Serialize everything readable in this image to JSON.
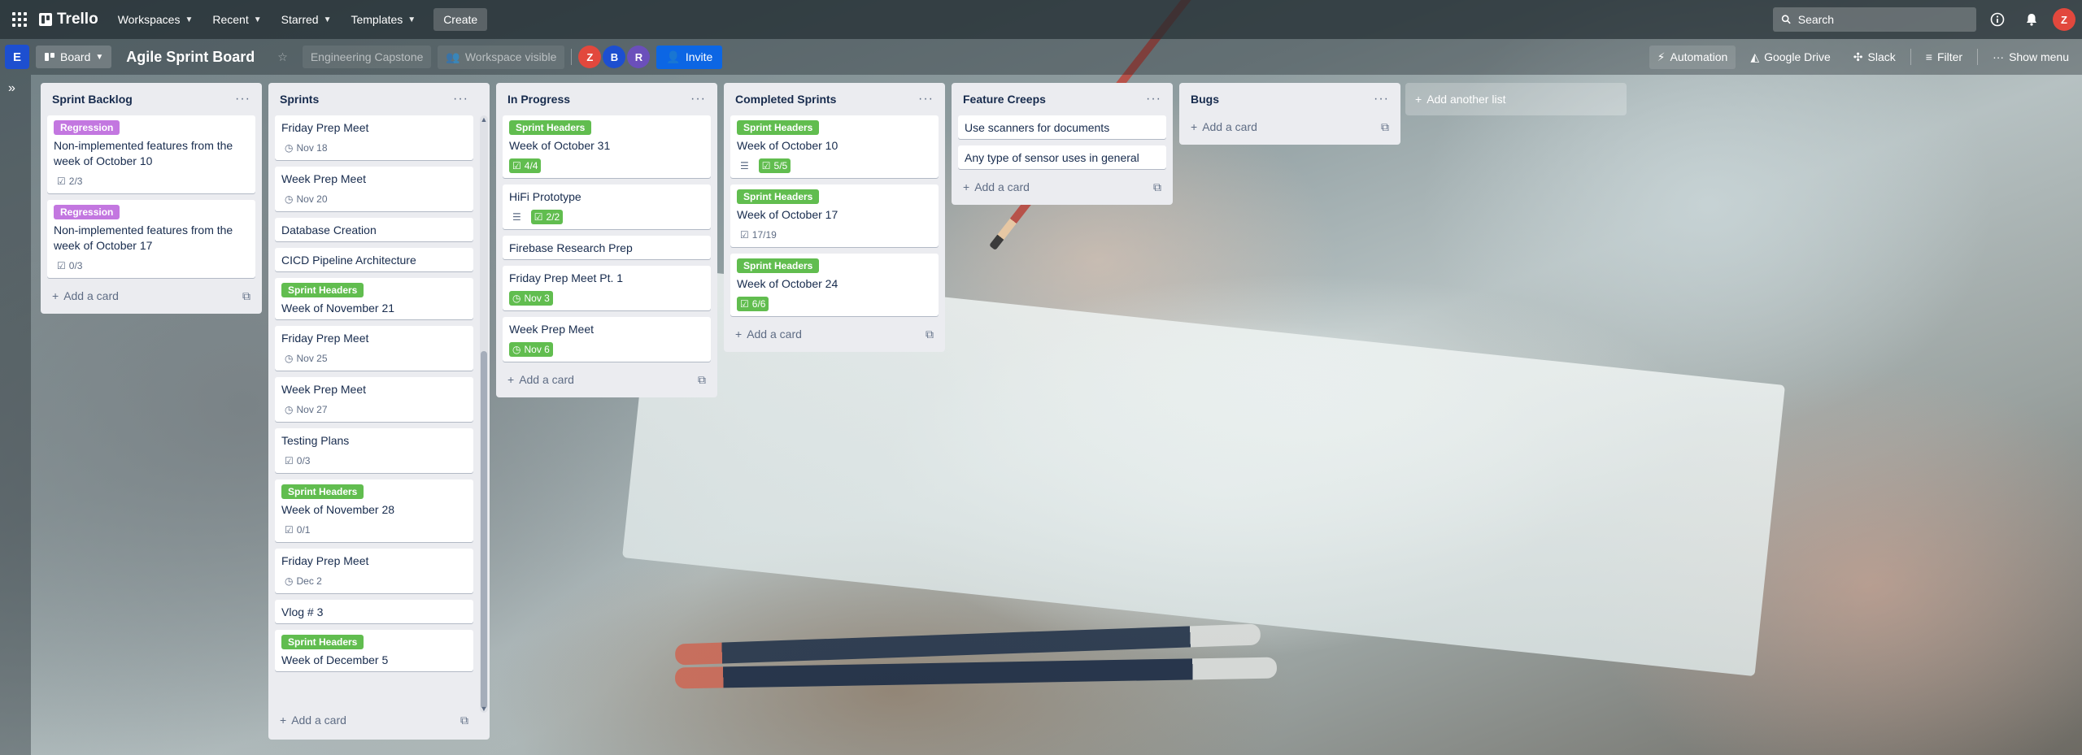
{
  "nav": {
    "logo": "Trello",
    "workspaces": "Workspaces",
    "recent": "Recent",
    "starred": "Starred",
    "templates": "Templates",
    "create": "Create",
    "search_placeholder": "Search",
    "user_initial": "Z",
    "user_color": "#e2483d"
  },
  "board": {
    "workspace_initial": "E",
    "view": "Board",
    "title": "Agile Sprint Board",
    "workspace_name": "Engineering Capstone",
    "visibility": "Workspace visible",
    "members": [
      {
        "initial": "Z",
        "color": "#e2483d"
      },
      {
        "initial": "B",
        "color": "#1d4fd0"
      },
      {
        "initial": "R",
        "color": "#6b4fbb"
      }
    ],
    "invite": "Invite",
    "automation": "Automation",
    "google_drive": "Google Drive",
    "slack": "Slack",
    "filter": "Filter",
    "show_menu": "Show menu"
  },
  "add_card_label": "Add a card",
  "add_list_label": "Add another list",
  "lists": [
    {
      "title": "Sprint Backlog",
      "cards": [
        {
          "label": "Regression",
          "label_color": "purple",
          "title": "Non-implemented features from the week of October 10",
          "checklist": "2/3"
        },
        {
          "label": "Regression",
          "label_color": "purple",
          "title": "Non-implemented features from the week of October 17",
          "checklist": "0/3"
        }
      ]
    },
    {
      "title": "Sprints",
      "cards": [
        {
          "title": "Friday Prep Meet",
          "due": "Nov 18"
        },
        {
          "title": "Week Prep Meet",
          "due": "Nov 20"
        },
        {
          "title": "Database Creation"
        },
        {
          "title": "CICD Pipeline Architecture"
        },
        {
          "label": "Sprint Headers",
          "label_color": "green",
          "title": "Week of November 21"
        },
        {
          "title": "Friday Prep Meet",
          "due": "Nov 25"
        },
        {
          "title": "Week Prep Meet",
          "due": "Nov 27"
        },
        {
          "title": "Testing Plans",
          "checklist": "0/3"
        },
        {
          "label": "Sprint Headers",
          "label_color": "green",
          "title": "Week of November 28",
          "checklist": "0/1"
        },
        {
          "title": "Friday Prep Meet",
          "due": "Dec 2"
        },
        {
          "title": "Vlog # 3"
        },
        {
          "label": "Sprint Headers",
          "label_color": "green",
          "title": "Week of December 5"
        }
      ]
    },
    {
      "title": "In Progress",
      "cards": [
        {
          "label": "Sprint Headers",
          "label_color": "green",
          "title": "Week of October 31",
          "checklist_done": "4/4"
        },
        {
          "title": "HiFi Prototype",
          "description": true,
          "checklist_done": "2/2"
        },
        {
          "title": "Firebase Research Prep"
        },
        {
          "title": "Friday Prep Meet Pt. 1",
          "due_done": "Nov 3"
        },
        {
          "title": "Week Prep Meet",
          "due_done": "Nov 6"
        }
      ]
    },
    {
      "title": "Completed Sprints",
      "cards": [
        {
          "label": "Sprint Headers",
          "label_color": "green",
          "title": "Week of October 10",
          "description": true,
          "checklist_done": "5/5"
        },
        {
          "label": "Sprint Headers",
          "label_color": "green",
          "title": "Week of October 17",
          "checklist": "17/19"
        },
        {
          "label": "Sprint Headers",
          "label_color": "green",
          "title": "Week of October 24",
          "checklist_done": "6/6"
        }
      ]
    },
    {
      "title": "Feature Creeps",
      "cards": [
        {
          "title": "Use scanners for documents"
        },
        {
          "title": "Any type of sensor uses in general"
        }
      ]
    },
    {
      "title": "Bugs",
      "cards": []
    }
  ]
}
